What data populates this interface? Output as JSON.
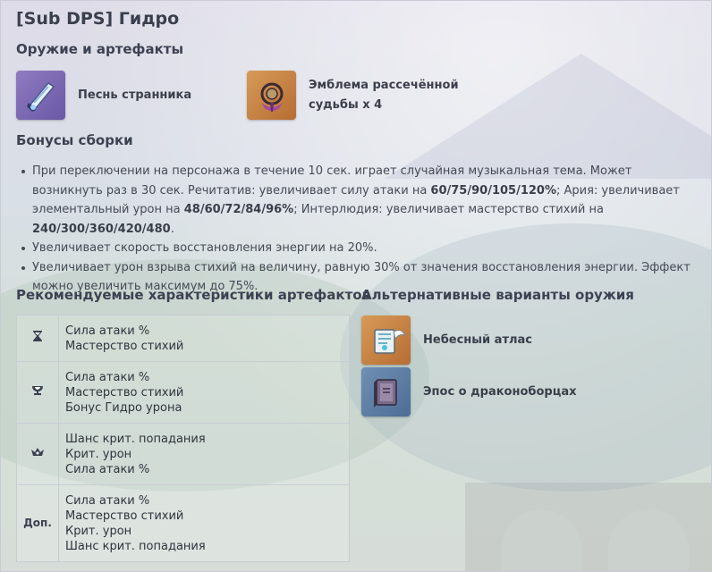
{
  "title": "[Sub DPS] Гидро",
  "weapons_artifacts": {
    "heading": "Оружие и артефакты",
    "items": [
      {
        "name": "Песнь странника",
        "icon": "elegy-sword-icon",
        "tile_color": "#7c68b4"
      },
      {
        "name": "Эмблема рассечённой",
        "name_line2": "судьбы x 4",
        "icon": "emblem-of-severed-fate-icon",
        "tile_color": "#c58445"
      }
    ]
  },
  "set_bonuses": {
    "heading": "Бонусы сборки",
    "items": [
      {
        "t1": "При переключении на персонажа в течение 10 сек. играет случайная музыкальная тема. Может возникнуть раз в 30 сек. Речитатив: увеличивает силу атаки на ",
        "b1": "60/75/90/105/120%",
        "t2": "; Ария: увеличивает элементальный урон на ",
        "b2": "48/60/72/84/96%",
        "t3": "; Интерлюдия: увеличивает мастерство стихий на ",
        "b3": "240/300/360/420/480",
        "t4": "."
      },
      {
        "t1": "Увеличивает скорость восстановления энергии на 20%."
      },
      {
        "t1": "Увеличивает урон взрыва стихий на величину, равную 30% от значения восстановления энергии. Эффект можно увеличить максимум до 75%."
      }
    ]
  },
  "recommended_stats": {
    "heading": "Рекомендуемые характеристики артефактов",
    "rows": [
      {
        "slot_icon": "sands-hourglass-icon",
        "slot_label": "",
        "lines": [
          "Сила атаки %",
          "Мастерство стихий"
        ]
      },
      {
        "slot_icon": "goblet-icon",
        "slot_label": "",
        "lines": [
          "Сила атаки %",
          "Мастерство стихий",
          "Бонус Гидро урона"
        ]
      },
      {
        "slot_icon": "circlet-crown-icon",
        "slot_label": "",
        "lines": [
          "Шанс крит. попадания",
          "Крит. урон",
          "Сила атаки %"
        ]
      },
      {
        "slot_icon": "",
        "slot_label": "Доп.",
        "lines": [
          "Сила атаки %",
          "Мастерство стихий",
          "Крит. урон",
          "Шанс крит. попадания"
        ]
      }
    ]
  },
  "alt_weapons": {
    "heading": "Альтернативные варианты оружия",
    "items": [
      {
        "name": "Небесный атлас",
        "icon": "skyward-atlas-icon",
        "tile_color": "#c58445"
      },
      {
        "name": "Эпос о драконоборцах",
        "icon": "thrilling-tales-book-icon",
        "tile_color": "#5b7ba3"
      }
    ]
  },
  "colors": {
    "text": "#3a3f4a",
    "border": "#c8ccd3",
    "rarity5": "#c58445",
    "rarity4": "#7c68b4",
    "rarity3": "#5b7ba3"
  }
}
